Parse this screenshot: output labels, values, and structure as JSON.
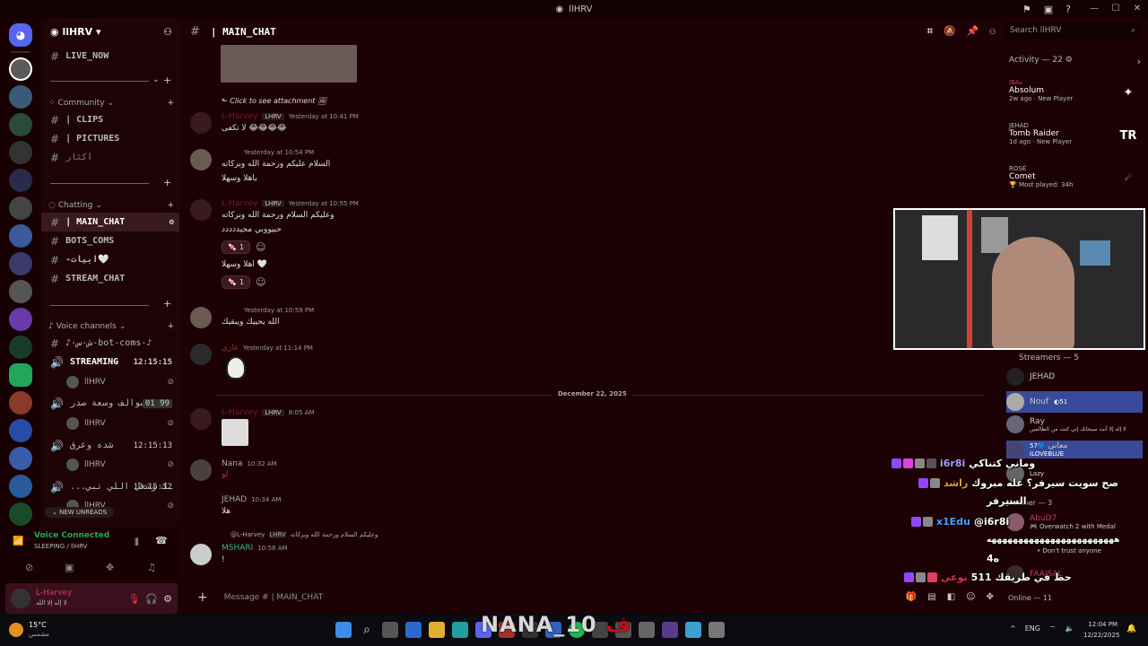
{
  "window": {
    "title": "llHRV"
  },
  "guild": {
    "name": "llHRV"
  },
  "channels": {
    "live_now": "LIVE_NOW",
    "community_cat": "Community",
    "clips": "| CLIPS",
    "pictures": "| PICTURES",
    "akthar": "اكثار",
    "chatting_cat": "Chatting",
    "main_chat": "| MAIN_CHAT",
    "bots_coms": "BOTS_COMS",
    "abyat": "-ابيات🤍",
    "stream_chat": "STREAM_CHAT",
    "voice_cat": "Voice channels",
    "bot_coms_voice": "♪-ش-س-bot-coms-♪",
    "streaming": "STREAMING",
    "streaming_timer": "12:15:15",
    "streaming_user": "llHRV",
    "sawalef": "سوالف وسعة صدر",
    "sawalef_count": "01",
    "sawalef_max": "99",
    "sawalef_user": "llHRV",
    "shadda": "شده وعرق",
    "shadda_timer": "12:15:13",
    "shadda_user": "llHRV",
    "third": "...ـك وشغل اللي تبي",
    "third_timer": "12:15:12",
    "third_user": "llHRV",
    "new_unreads": "NEW UNREADS"
  },
  "voice": {
    "status": "Voice Connected",
    "detail": "SLEEPING / llHRV"
  },
  "user": {
    "name": "L-Harvey",
    "status": "لا إله إلا الله"
  },
  "chat_header": {
    "channel": "| MAIN_CHAT"
  },
  "search": {
    "placeholder": "Search llHRV"
  },
  "messages": {
    "m0_reply": "Click to see attachment",
    "m1_name": "L-Harvey",
    "m1_tag": "LHRV",
    "m1_time": "Yesterday at 10:41 PM",
    "m1_text": "لا تكفى 😂😂😂😂",
    "m2_time": "Yesterday at 10:54 PM",
    "m2_text1": "السلام عليكم ورحمة الله وبركاته",
    "m2_text2": "ياهلا وسهلا",
    "m3_name": "L-Harvey",
    "m3_tag": "LHRV",
    "m3_time": "Yesterday at 10:55 PM",
    "m3_text1": "وعليكم السلام ورحمة الله وبركاته",
    "m3_text2": "حبيووبي مجيددددد",
    "m3_react1": "1",
    "m3_text3": "اهلا وسهلا 🤍",
    "m3_react2": "1",
    "m4_time": "Yesterday at 10:59 PM",
    "m4_text": "الله يحييك ويبقيك",
    "m5_name": "غازي",
    "m5_time": "Yesterday at 11:14 PM",
    "date_sep": "December 22, 2025",
    "m6_name": "L-Harvey",
    "m6_tag": "LHRV",
    "m6_time": "8:05 AM",
    "m7_name": "Nana",
    "m7_time": "10:32 AM",
    "m7_text": "لو",
    "m8_name": "JEHAD",
    "m8_time": "10:34 AM",
    "m8_text": "هلا",
    "m9_reply_name": "@L-Harvey",
    "m9_reply_tag": "LHRV",
    "m9_reply_text": "وعليكم السلام ورحمة الله وبركاته",
    "m9_name": "MSHARI",
    "m9_time": "10:58 AM",
    "m9_text": "!"
  },
  "composer": {
    "placeholder": "Message # | MAIN_CHAT"
  },
  "activity": {
    "title": "Activity — 22",
    "items": [
      {
        "user": "IBAه",
        "game": "Absolum",
        "meta": "2w ago",
        "extra": "New Player"
      },
      {
        "user": "JEHAD",
        "game": "Tomb Raider",
        "meta": "1d ago",
        "extra": "New Player",
        "logo": "TR"
      },
      {
        "user": "ROSÉ",
        "game": "Comet",
        "meta": "Most played: 34h"
      }
    ]
  },
  "members": {
    "streamers_title": "Streamers — 5",
    "s1": "JEHAD",
    "s2": "Nouf",
    "s2_badge": "51",
    "s3": "Ray",
    "s3_status": "لا إله إلا أنت سبحانك إني كنت من الظالمين",
    "s4": "معاني",
    "s4_badge": "57",
    "s4_status": "ILOVEBLUE",
    "s5": "Lazy",
    "member_title": "Member — 3",
    "m1": "AbuD7",
    "m1_status": "Overwatch 2 with Medal",
    "m2_status": "Don't trust anyone",
    "m3": "FAAISAL",
    "online_title": "Online — 11"
  },
  "overlay": {
    "c1_name": "i6r8i",
    "c1_text": "وماني كتناكي",
    "c2_name": "راشد",
    "c2_text": "صح سويت سيرفر؟ عله مبروك",
    "c2_cont": "السيرفر",
    "c3_name": "x1Edu",
    "c3_text": "@i6r8i",
    "c3_cont": "ههههههههههههههههههههههههه",
    "c3_cont2": "4ه",
    "c4_name": "نوعي",
    "c4_text": "حط في طريقك 511"
  },
  "stream_overlay": {
    "name": "NANA_10",
    "suffix": "ف"
  },
  "taskbar": {
    "weather": "15°C",
    "weather_desc": "مشمس",
    "lang": "ENG",
    "time": "12:04 PM",
    "date": "12/22/2025"
  }
}
